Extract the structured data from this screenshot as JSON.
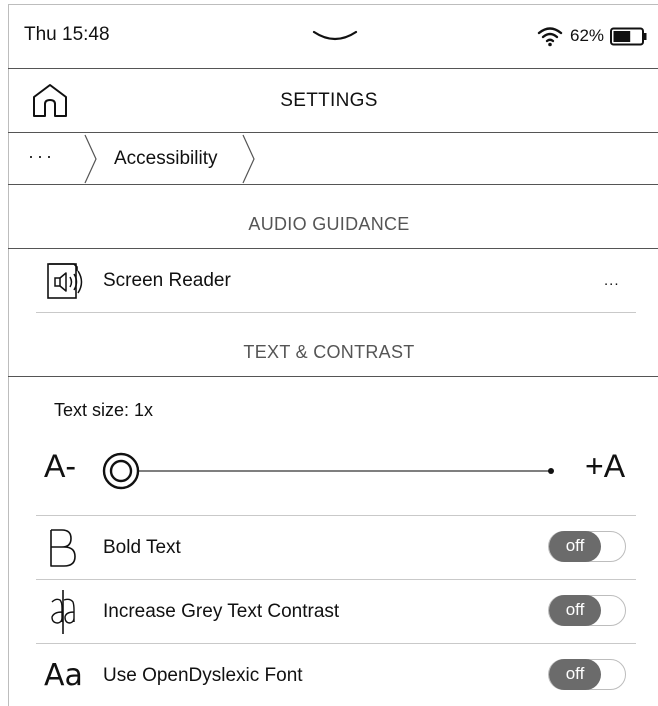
{
  "status_bar": {
    "time": "Thu 15:48",
    "battery_percent": "62%",
    "battery_level": 0.62,
    "wifi_icon": "wifi-icon",
    "pull_down_icon": "chevron-down-icon"
  },
  "header": {
    "title": "SETTINGS",
    "home_icon": "home-icon"
  },
  "breadcrumb": {
    "more": "···",
    "current": "Accessibility"
  },
  "sections": {
    "audio_guidance": {
      "title": "AUDIO GUIDANCE",
      "screen_reader": {
        "label": "Screen Reader",
        "more": "...",
        "icon": "speaker-icon"
      }
    },
    "text_contrast": {
      "title": "TEXT & CONTRAST",
      "text_size": {
        "label": "Text size: 1x",
        "min_label": "A-",
        "max_label": "+A",
        "slider_value": 0
      },
      "bold_text": {
        "label": "Bold Text",
        "toggle": "off",
        "icon": "bold-b-icon"
      },
      "grey_contrast": {
        "label": "Increase Grey Text Contrast",
        "toggle": "off",
        "icon": "contrast-text-icon"
      },
      "dyslexic_font": {
        "label": "Use OpenDyslexic Font",
        "toggle": "off",
        "icon": "Aa"
      }
    }
  },
  "colors": {
    "toggle_off": "#6b6b6b",
    "divider": "#8a8a8a",
    "section_text": "#555555"
  }
}
